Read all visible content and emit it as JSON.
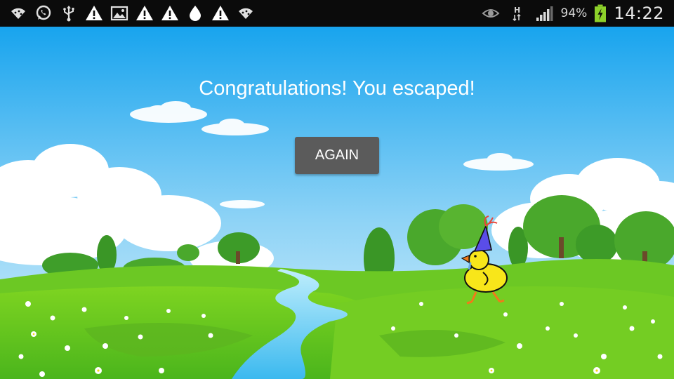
{
  "status_bar": {
    "left_icons": [
      "wifi-icon",
      "whatsapp-icon",
      "usb-icon",
      "warning-icon",
      "gallery-icon",
      "warning-icon",
      "warning-icon",
      "drop-icon",
      "warning-icon",
      "wifi-icon"
    ],
    "right_icons": [
      "eye-icon",
      "hspa-icon",
      "signal-icon"
    ],
    "battery_percent": "94%",
    "time": "14:22"
  },
  "game": {
    "message": "Congratulations! You escaped!",
    "again_label": "AGAIN"
  },
  "colors": {
    "status_bar_bg": "#0b0b0b",
    "sky_top": "#1aa6ee",
    "grass": "#5bc21e",
    "button_bg": "#5b5b5b",
    "battery_green": "#8dd12a"
  }
}
